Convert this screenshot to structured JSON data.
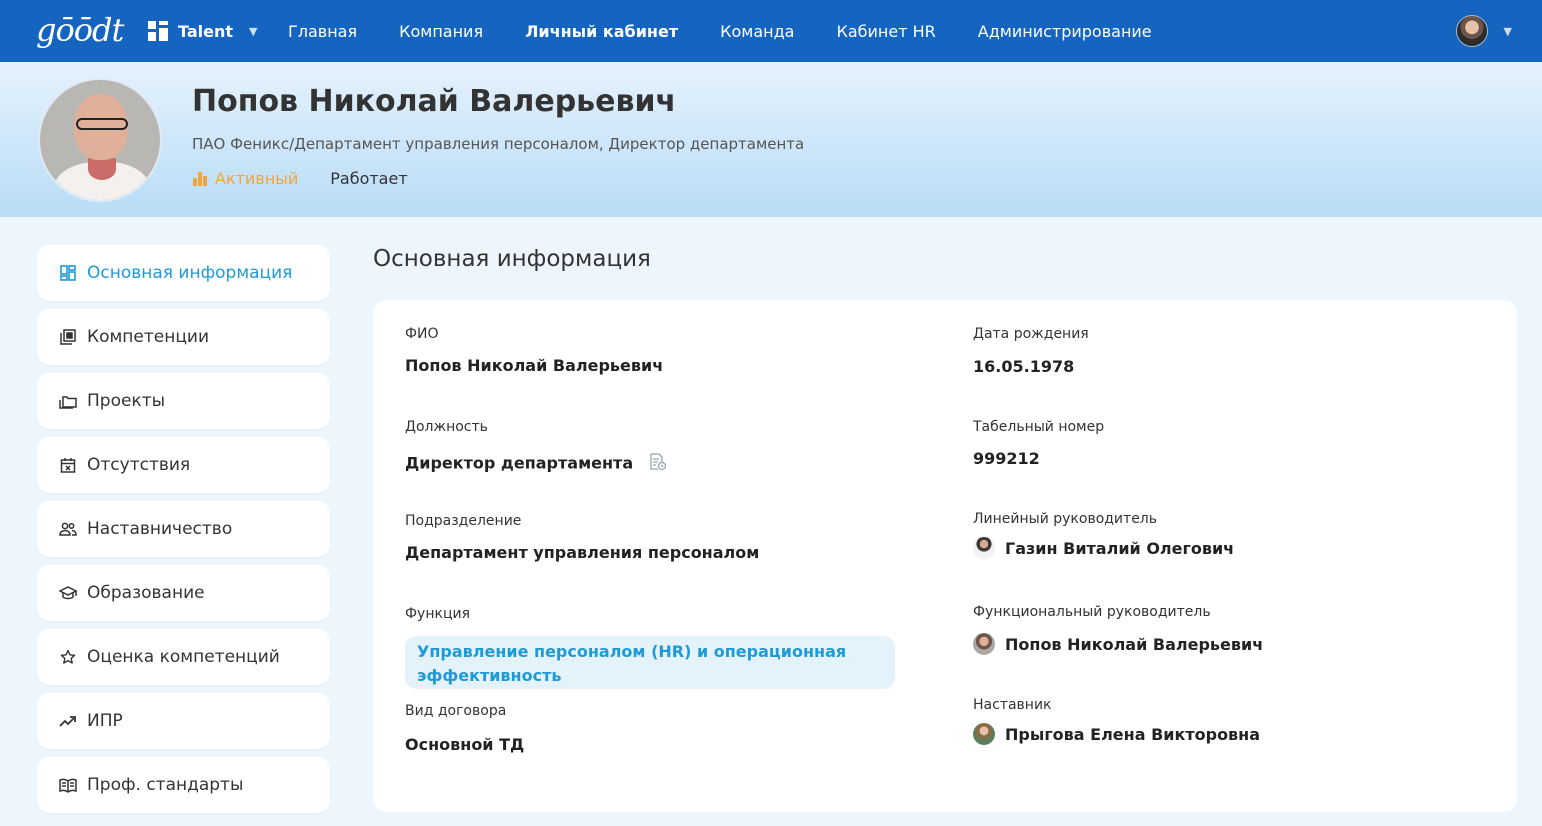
{
  "nav": {
    "logo": "gōōdt",
    "app_label": "Talent",
    "items": [
      "Главная",
      "Компания",
      "Личный кабинет",
      "Команда",
      "Кабинет HR",
      "Администрирование"
    ],
    "active_index": 2
  },
  "profile": {
    "name": "Попов Николай Валерьевич",
    "org": "ПАО Феникс/Департамент управления персоналом, Директор департамента",
    "status_active": "Активный",
    "status_working": "Работает"
  },
  "sidebar": {
    "items": [
      {
        "label": "Основная информация",
        "icon": "dashboard-icon",
        "active": true
      },
      {
        "label": "Компетенции",
        "icon": "competencies-icon"
      },
      {
        "label": "Проекты",
        "icon": "projects-icon"
      },
      {
        "label": "Отсутствия",
        "icon": "calendar-icon"
      },
      {
        "label": "Наставничество",
        "icon": "people-icon"
      },
      {
        "label": "Образование",
        "icon": "graduation-cap-icon"
      },
      {
        "label": "Оценка компетенций",
        "icon": "star-icon"
      },
      {
        "label": "ИПР",
        "icon": "trending-up-icon"
      },
      {
        "label": "Проф. стандарты",
        "icon": "book-icon"
      }
    ]
  },
  "main": {
    "title": "Основная информация",
    "fio_label": "ФИО",
    "fio_value": "Попов Николай Валерьевич",
    "position_label": "Должность",
    "position_value": "Директор департамента",
    "division_label": "Подразделение",
    "division_value": "Департамент управления персоналом",
    "function_label": "Функция",
    "function_value": "Управление персоналом (HR) и операционная эффективность",
    "contract_label": "Вид договора",
    "contract_value": "Основной ТД",
    "birth_label": "Дата рождения",
    "birth_value": "16.05.1978",
    "tab_label": "Табельный номер",
    "tab_value": "999212",
    "line_manager_label": "Линейный руководитель",
    "line_manager_value": "Газин Виталий Олегович",
    "func_manager_label": "Функциональный руководитель",
    "func_manager_value": "Попов Николай Валерьевич",
    "mentor_label": "Наставник",
    "mentor_value": "Прыгова Елена Викторовна"
  },
  "colors": {
    "nav_bg": "#1565c0",
    "accent": "#1e9ad6",
    "status_active": "#f0a63c"
  }
}
